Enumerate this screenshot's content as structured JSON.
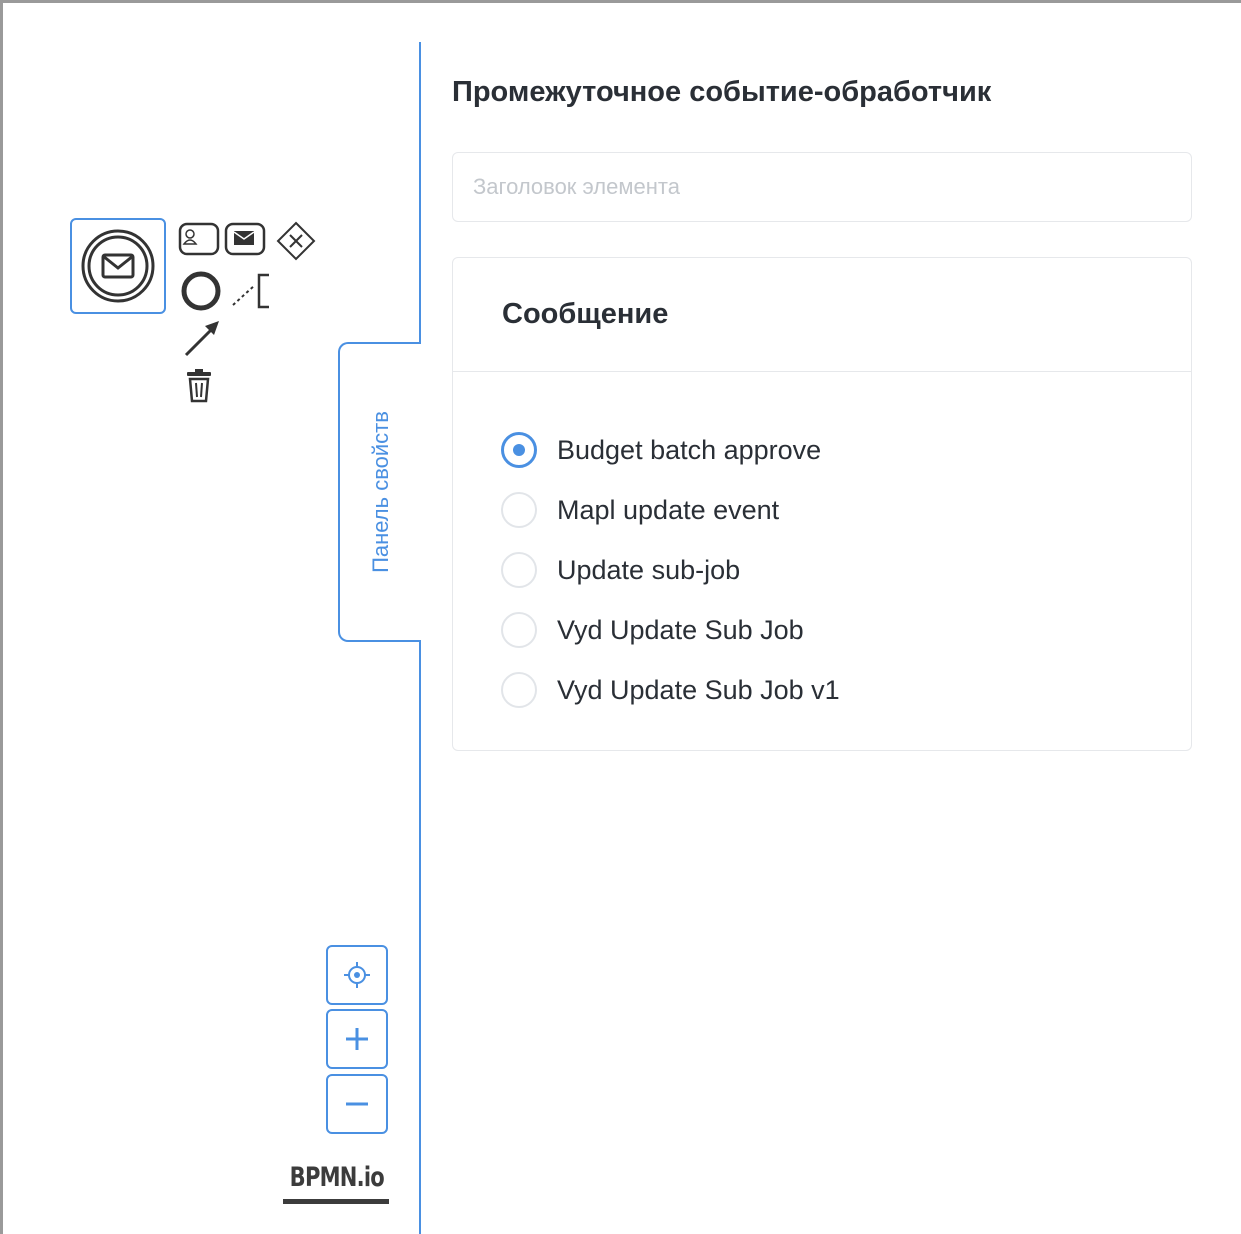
{
  "canvas": {
    "context_pad": {
      "items": [
        {
          "name": "user-task-icon"
        },
        {
          "name": "message-task-icon"
        },
        {
          "name": "exclusive-gateway-icon"
        },
        {
          "name": "end-event-icon"
        },
        {
          "name": "text-annotation-icon"
        },
        {
          "name": "connect-arrow-icon"
        },
        {
          "name": "delete-trash-icon"
        }
      ]
    },
    "zoom_controls": [
      "reset-focus-icon",
      "zoom-in-icon",
      "zoom-out-icon"
    ],
    "logo": "BPMN.io"
  },
  "sidebar": {
    "tab_label": "Панель свойств",
    "accent_color": "#4a90e2"
  },
  "properties": {
    "title": "Промежуточное событие-обработчик",
    "name_input": {
      "value": "",
      "placeholder": "Заголовок элемента"
    },
    "message_section": {
      "header": "Сообщение",
      "options": [
        {
          "label": "Budget batch approve",
          "checked": true
        },
        {
          "label": "Mapl update event",
          "checked": false
        },
        {
          "label": "Update sub-job",
          "checked": false
        },
        {
          "label": "Vyd Update Sub Job",
          "checked": false
        },
        {
          "label": "Vyd Update Sub Job v1",
          "checked": false
        }
      ]
    }
  }
}
